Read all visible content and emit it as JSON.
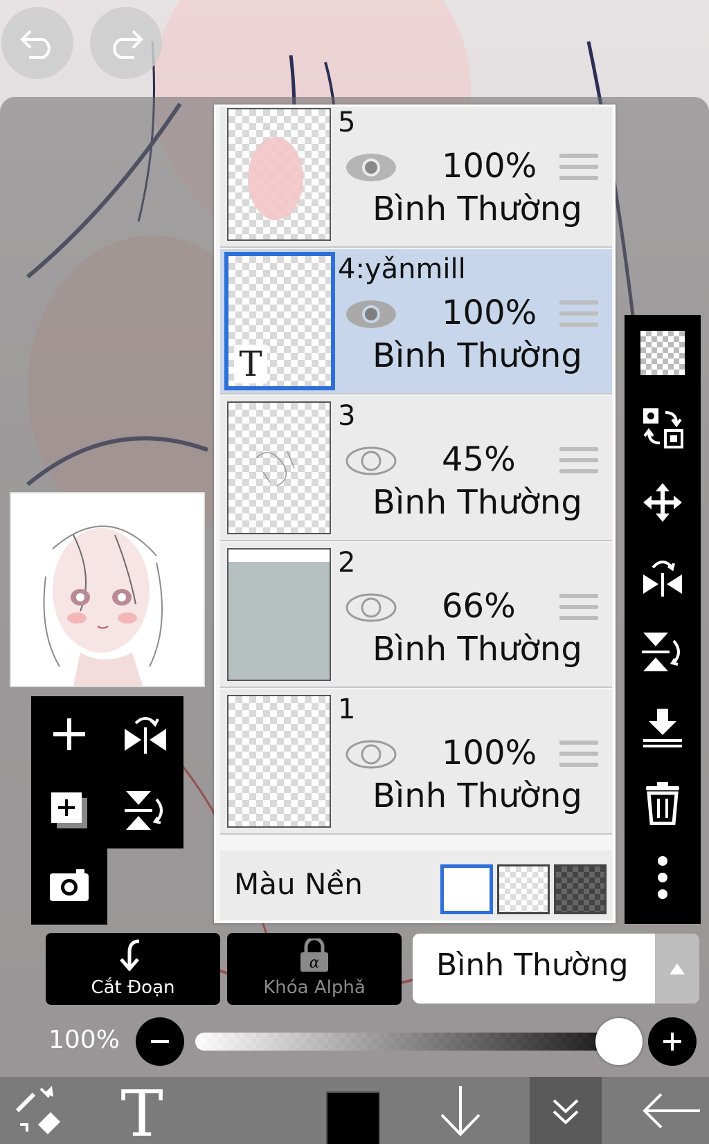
{
  "top_controls": {
    "undo_icon": "undo-icon",
    "redo_icon": "redo-icon"
  },
  "layers": [
    {
      "name": "5",
      "opacity": "100%",
      "blend": "Bình Thường",
      "visible": true,
      "selected": false,
      "thumb": "pink-face"
    },
    {
      "name": "4:yǎnmill",
      "opacity": "100%",
      "blend": "Bình Thường",
      "visible": true,
      "selected": true,
      "thumb": "text",
      "thumb_text": "T"
    },
    {
      "name": "3",
      "opacity": "45%",
      "blend": "Bình Thường",
      "visible": true,
      "selected": false,
      "thumb": "sketch"
    },
    {
      "name": "2",
      "opacity": "66%",
      "blend": "Bình Thường",
      "visible": true,
      "selected": false,
      "thumb": "gray-fill"
    },
    {
      "name": "1",
      "opacity": "100%",
      "blend": "Bình Thường",
      "visible": true,
      "selected": false,
      "thumb": "empty"
    }
  ],
  "background_color": {
    "label": "Màu Nền",
    "options": [
      "white",
      "transparent",
      "dark-checker"
    ],
    "selected": "white"
  },
  "right_toolbar": [
    "transparency-checker-icon",
    "transfer-layer-icon",
    "move-icon",
    "flip-horizontal-icon",
    "flip-vertical-icon",
    "merge-down-icon",
    "trash-icon",
    "more-vertical-icon"
  ],
  "left_toolbar": [
    "add-layer-icon",
    "rotate-flip-icon",
    "duplicate-layer-icon",
    "flip-rotate-vertical-icon",
    "camera-icon"
  ],
  "panel_buttons": {
    "clipping": "Cắt Đoạn",
    "alpha_lock": "Khóa Alphǎ"
  },
  "blend_mode": {
    "value": "Bình Thường"
  },
  "opacity": {
    "label": "100%",
    "value": 100
  },
  "colors": {
    "selected_layer": "#c7d6ea",
    "selection_border": "#2f6fd8",
    "toolbar": "#000000",
    "primary_color": "#000000"
  },
  "bottom_toolbar": [
    "brush-eraser-icon",
    "text-tool-icon",
    "color-swatch",
    "arrow-down-icon",
    "double-chevron-down-icon",
    "back-arrow-icon"
  ]
}
